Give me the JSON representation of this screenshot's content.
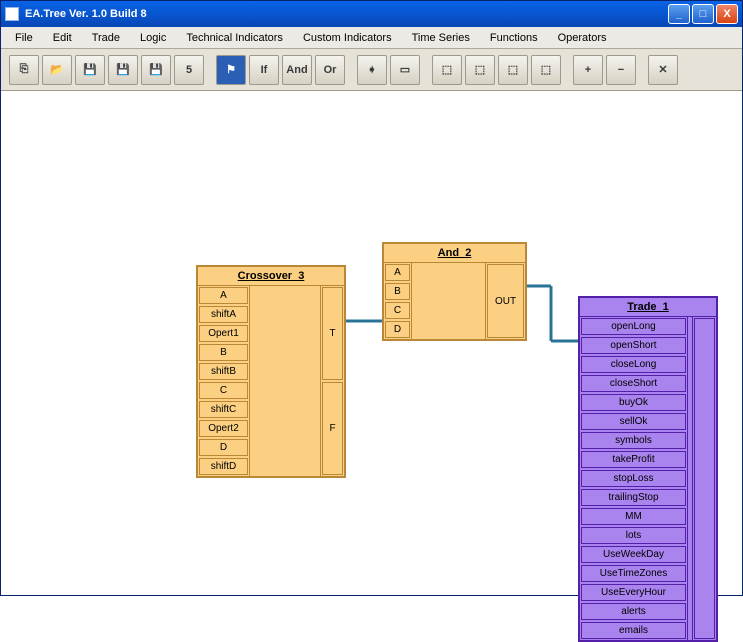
{
  "window": {
    "title": "EA.Tree Ver. 1.0 Build 8"
  },
  "menu": [
    "File",
    "Edit",
    "Trade",
    "Logic",
    "Technical Indicators",
    "Custom Indicators",
    "Time Series",
    "Functions",
    "Operators"
  ],
  "toolbar": {
    "btn_new": "⎘",
    "btn_open": "📂",
    "btn_save": "💾",
    "btn_saveas": "💾",
    "btn_save2": "💾",
    "btn_sheet": "5",
    "btn_flag": "⚑",
    "btn_if": "If",
    "btn_and": "And",
    "btn_or": "Or",
    "btn_right": "➧",
    "btn_frame": "▭",
    "btn_n1": "⬚",
    "btn_n2": "⬚",
    "btn_n3": "⬚",
    "btn_n4": "⬚",
    "btn_plus": "+",
    "btn_minus": "−",
    "btn_x": "✕"
  },
  "nodes": {
    "crossover": {
      "title": "Crossover_3",
      "inputs": [
        "A",
        "shiftA",
        "Opert1",
        "B",
        "shiftB",
        "C",
        "shiftC",
        "Opert2",
        "D",
        "shiftD"
      ],
      "outputs": [
        "T",
        "F"
      ]
    },
    "and2": {
      "title": "And_2",
      "inputs": [
        "A",
        "B",
        "C",
        "D"
      ],
      "outputs": [
        "OUT"
      ]
    },
    "trade": {
      "title": "Trade_1",
      "inputs": [
        "openLong",
        "openShort",
        "closeLong",
        "closeShort",
        "buyOk",
        "sellOk",
        "symbols",
        "takeProfit",
        "stopLoss",
        "trailingStop",
        "MM",
        "lots",
        "UseWeekDay",
        "UseTimeZones",
        "UseEveryHour",
        "alerts",
        "emails"
      ]
    }
  }
}
